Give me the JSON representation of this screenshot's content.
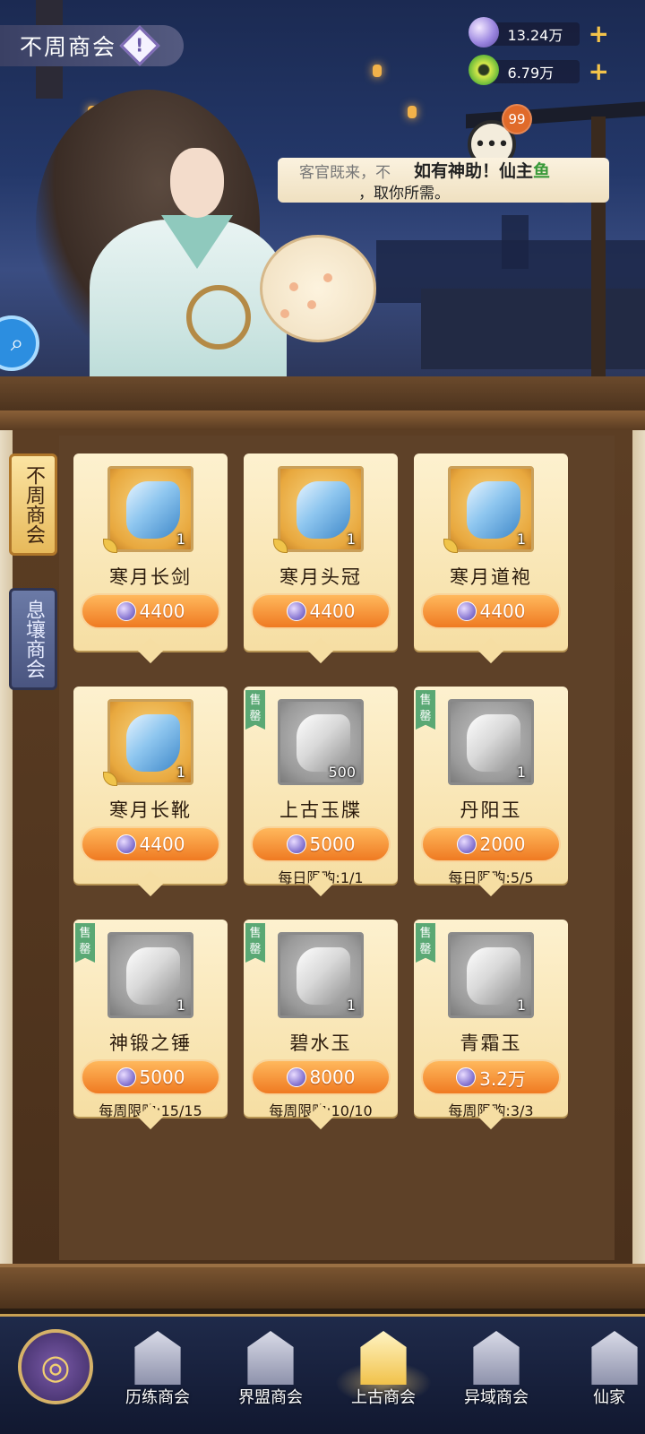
{
  "header": {
    "title": "不周商会",
    "currencies": [
      {
        "value": "13.24万",
        "icon": "spirit-gem-icon",
        "plus": "+"
      },
      {
        "value": "6.79万",
        "icon": "jade-eye-icon",
        "plus": "+"
      }
    ],
    "chat_badge": "99"
  },
  "npc": {
    "bubble_line1": "客官既来，不",
    "headline": "如有神助！仙主",
    "headline_tail": "鱼",
    "bubble_line2": "，取你所需。"
  },
  "tabs": [
    {
      "label": "不周商会",
      "active": true
    },
    {
      "label": "息壤商会",
      "active": false
    }
  ],
  "items": [
    {
      "name": "寒月长剑",
      "price": "4400",
      "count": "1",
      "style": "gold",
      "limit": "",
      "soldout": ""
    },
    {
      "name": "寒月头冠",
      "price": "4400",
      "count": "1",
      "style": "gold",
      "limit": "",
      "soldout": ""
    },
    {
      "name": "寒月道袍",
      "price": "4400",
      "count": "1",
      "style": "gold",
      "limit": "",
      "soldout": ""
    },
    {
      "name": "寒月长靴",
      "price": "4400",
      "count": "1",
      "style": "gold",
      "limit": "",
      "soldout": ""
    },
    {
      "name": "上古玉牒",
      "price": "5000",
      "count": "500",
      "style": "gray",
      "limit": "每日限购:1/1",
      "soldout": "售罄"
    },
    {
      "name": "丹阳玉",
      "price": "2000",
      "count": "1",
      "style": "gray",
      "limit": "每日限购:5/5",
      "soldout": "售罄"
    },
    {
      "name": "神锻之锤",
      "price": "5000",
      "count": "1",
      "style": "gray",
      "limit": "每周限购:15/15",
      "soldout": "售罄"
    },
    {
      "name": "碧水玉",
      "price": "8000",
      "count": "1",
      "style": "gray",
      "limit": "每周限购:10/10",
      "soldout": "售罄"
    },
    {
      "name": "青霜玉",
      "price": "3.2万",
      "count": "1",
      "style": "gray",
      "limit": "每周限购:3/3",
      "soldout": "售罄"
    }
  ],
  "nav": {
    "items": [
      {
        "label": "历练商会",
        "icon": "training-hall-icon"
      },
      {
        "label": "界盟商会",
        "icon": "alliance-gate-icon"
      },
      {
        "label": "上古商会",
        "icon": "ancient-shrine-icon",
        "active": true
      },
      {
        "label": "异域商会",
        "icon": "foreign-gate-icon"
      },
      {
        "label": "仙家",
        "icon": "immortal-house-icon"
      }
    ]
  }
}
